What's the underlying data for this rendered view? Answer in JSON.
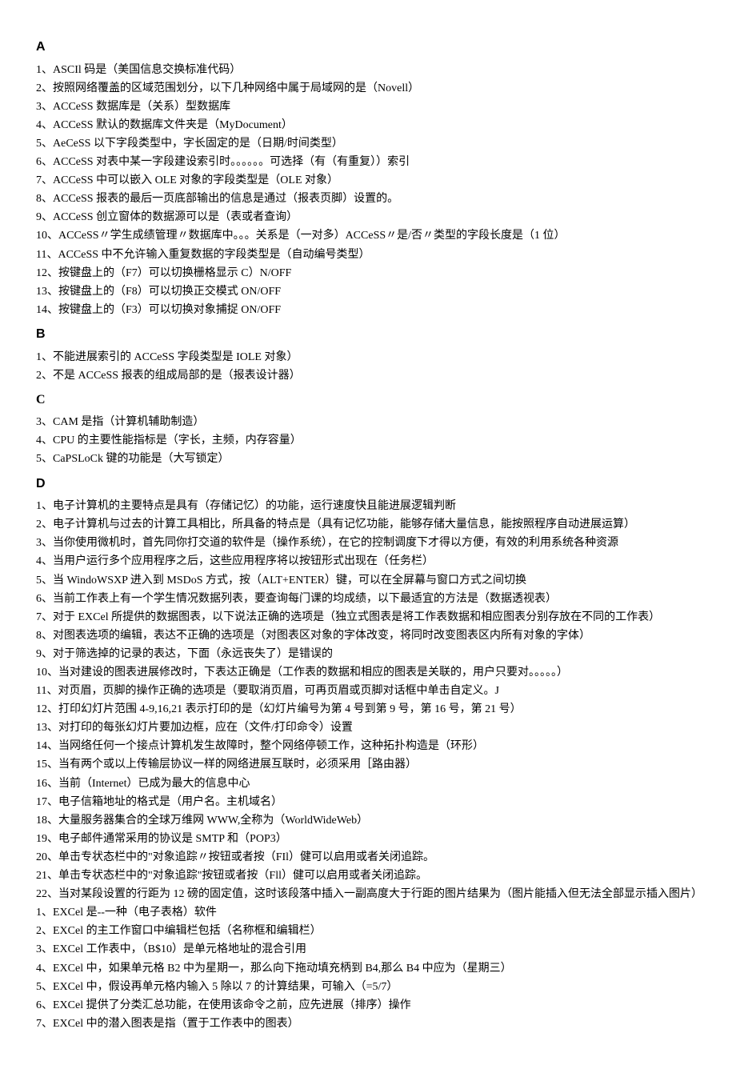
{
  "sections": [
    {
      "header": "A",
      "headerClass": "",
      "items": [
        "1、ASCIl 码是（美国信息交换标准代码）",
        "2、按照网络覆盖的区域范围划分，以下几种网络中属于局域网的是（Novell）",
        "3、ACCeSS 数据库是（关系）型数据库",
        "4、ACCeSS 默认的数据库文件夹是（MyDocument）",
        "5、AeCeSS 以下字段类型中，字长固定的是（日期/时间类型）",
        "6、ACCeSS 对表中某一字段建设索引时。。。。。。可选择（有（有重复））索引",
        "7、ACCeSS 中可以嵌入 OLE 对象的字段类型是（OLE 对象）",
        "8、ACCeSS 报表的最后一页底部输出的信息是通过（报表页脚）设置的。",
        "9、ACCeSS 创立窗体的数据源可以是（表或者查询）",
        "10、ACCeSS〃学生成绩管理〃数据库中。。。关系是（一对多）ACCeSS〃是/否〃类型的字段长度是（1 位）",
        "11、ACCeSS 中不允许输入重复数据的字段类型是（自动编号类型）",
        "12、按键盘上的（F7）可以切换栅格显示 C）N/OFF",
        "13、按键盘上的（F8）可以切换正交模式 ON/OFF",
        "14、按键盘上的（F3）可以切换对象捕捉 ON/OFF"
      ]
    },
    {
      "header": "B",
      "headerClass": "",
      "items": [
        "1、不能进展索引的 ACCeSS 字段类型是 IOLE 对象）",
        "2、不是 ACCeSS 报表的组成局部的是（报表设计器）"
      ]
    },
    {
      "header": "C",
      "headerClass": "serif",
      "items": [
        "3、CAM 是指（计算机辅助制造）",
        "4、CPU 的主要性能指标是（字长，主频，内存容量）",
        "5、CaPSLoCk 键的功能是（大写锁定）"
      ]
    },
    {
      "header": "D",
      "headerClass": "",
      "items": [
        "1、电子计算机的主要特点是具有（存储记忆）的功能，运行速度快且能进展逻辑判断",
        "2、电子计算机与过去的计算工具相比，所具备的特点是（具有记忆功能，能够存储大量信息，能按照程序自动进展运算）",
        "3、当你使用微机时，首先同你打交道的软件是（操作系统），在它的控制调度下才得以方便，有效的利用系统各种资源",
        "4、当用户运行多个应用程序之后，这些应用程序将以按钮形式出现在（任务栏）",
        "5、当 WindoWSXP 进入到 MSDoS 方式，按（ALT+ENTER）键，可以在全屏幕与窗口方式之间切换",
        "6、当前工作表上有一个学生情况数据列表，要查询每门课的均成绩，以下最适宜的方法是（数据透视表）",
        "7、对于 EXCel 所提供的数据图表，以下说法正确的选项是（独立式图表是将工作表数据和相应图表分别存放在不同的工作表）",
        "8、对图表选项的编辑，表达不正确的选项是（对图表区对象的字体改变，将同时改变图表区内所有对象的字体）",
        "9、对于筛选掉的记录的表达，下面（永远丧失了）是错误的",
        "10、当对建设的图表进展修改时，下表达正确是（工作表的数据和相应的图表是关联的，用户只要对。。。。。）",
        "11、对页眉，页脚的操作正确的选项是（要取消页眉，可再页眉或页脚对话框中单击自定义。J",
        "12、打印幻灯片范围 4-9,16,21 表示打印的是（幻灯片编号为第 4 号到第 9 号，第 16 号，第 21 号）",
        "13、对打印的每张幻灯片要加边框，应在（文件/打印命令）设置",
        "14、当网络任何一个接点计算机发生故障时，整个网络停顿工作，这种拓扑构造是（环形）",
        "15、当有两个或以上传输层协议一样的网络进展互联时，必须采用［路由器）",
        "16、当前（Internet）已成为最大的信息中心",
        "17、电子信箱地址的格式是（用户名。主机域名）",
        "18、大量服务器集合的全球万维网 WWW,全称为（WorldWideWeb）",
        "19、电子邮件通常采用的协议是 SMTP 和（POP3）",
        "20、单击专状态栏中的\"对象追踪〃按钮或者按（FIl）健可以启用或者关闭追踪。",
        "21、单击专状态栏中的\"对象追踪\"按钮或者按（Fll）健可以启用或者关闭追踪。",
        "22、当对某段设置的行距为 12 磅的固定值，这时该段落中插入一副高度大于行距的图片结果为（图片能插入但无法全部显示插入图片）1、EXCel 是--一种（电子表格）软件",
        "2、EXCel 的主工作窗口中编辑栏包括（名称框和编辑栏）",
        "3、EXCel 工作表中，（B$10）是单元格地址的混合引用",
        "4、EXCel 中，如果单元格 B2 中为星期一，那么向下拖动填充柄到 B4,那么 B4 中应为（星期三）",
        "5、EXCel 中，假设再单元格内输入 5 除以 7 的计算结果，可输入（=5/7）",
        "6、EXCel 提供了分类汇总功能，在使用该命令之前，应先进展（排序）操作",
        "7、EXCel 中的潜入图表是指（置于工作表中的图表）"
      ]
    }
  ]
}
